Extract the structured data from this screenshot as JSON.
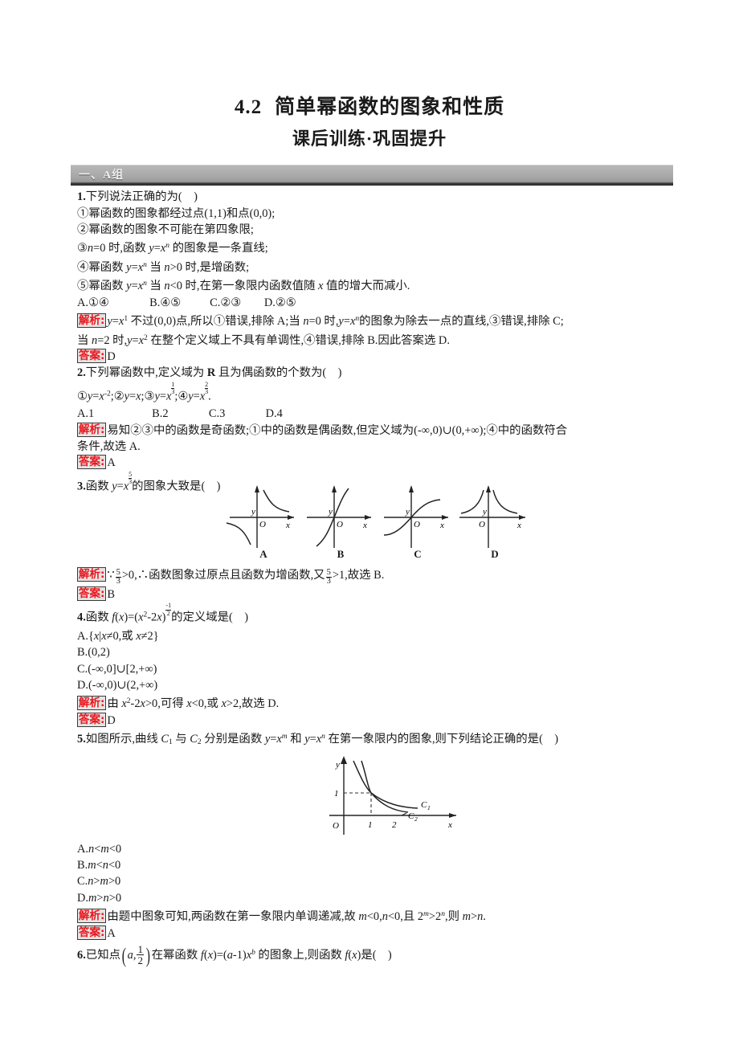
{
  "header": {
    "section_number": "4.2",
    "title": "简单幂函数的图象和性质",
    "subtitle": "课后训练·巩固提升",
    "group_bar_label": "一、A组",
    "bar_color": "#a8a8a8",
    "tag_color": "#e8161c"
  },
  "labels": {
    "analysis": "解析:",
    "answer": "答案:"
  },
  "questions": [
    {
      "number": "1.",
      "stem": "下列说法正确的为(　　)",
      "items": [
        "①幂函数的图象都经过点(1,1)和点(0,0);",
        "②幂函数的图象不可能在第四象限;",
        "③n=0 时,函数 y=xⁿ 的图象是一条直线;",
        "④幂函数 y=xⁿ 当 n>0 时,是增函数;",
        "⑤幂函数 y=xⁿ 当 n<0 时,在第一象限内函数值随 x 值的增大而减小."
      ],
      "options": [
        "A.①④",
        "B.④⑤",
        "C.②③",
        "D.②⑤"
      ],
      "analysis": "y=x¹ 不过(0,0)点,所以①错误,排除 A;当 n=0 时,y=xⁿ的图象为除去一点的直线,③错误,排除 C;当 n=2 时,y=x² 在整个定义域上不具有单调性,④错误,排除 B.因此答案选 D.",
      "answer": "D"
    },
    {
      "number": "2.",
      "stem": "下列幂函数中,定义域为 R 且为偶函数的个数为(　　)",
      "items": [
        "①y=x⁻²;②y=x;③y=x^(1/3);④y=x^(2/3)."
      ],
      "options": [
        "A.1",
        "B.2",
        "C.3",
        "D.4"
      ],
      "analysis": "易知②③中的函数是奇函数;①中的函数是偶函数,但定义域为(-∞,0)∪(0,+∞);④中的函数符合条件,故选 A.",
      "answer": "A"
    },
    {
      "number": "3.",
      "stem": "函数 y=x^(5/3)的图象大致是(　　)",
      "figure_labels": [
        "A",
        "B",
        "C",
        "D"
      ],
      "figure_axis_labels": {
        "y": "y",
        "x": "x",
        "origin": "O"
      },
      "analysis": "∵5/3>0,∴函数图象过原点且函数为增函数,又5/3>1,故选 B.",
      "answer": "B"
    },
    {
      "number": "4.",
      "stem": "函数 f(x)=(x²-2x)^(-1/2)的定义域是(　　)",
      "options": [
        "A.{x|x≠0,或 x≠2}",
        "B.(0,2)",
        "C.(-∞,0]∪[2,+∞)",
        "D.(-∞,0)∪(2,+∞)"
      ],
      "analysis": "由 x²-2x>0,可得 x<0,或 x>2,故选 D.",
      "answer": "D"
    },
    {
      "number": "5.",
      "stem": "如图所示,曲线 C₁ 与 C₂ 分别是函数 y=xᵐ 和 y=xⁿ 在第一象限内的图象,则下列结论正确的是(　　)",
      "figure": {
        "curve_labels": [
          "C₁",
          "C₂"
        ],
        "axis_labels": {
          "y": "y",
          "x": "x",
          "origin": "O"
        },
        "x_ticks": [
          "1",
          "2"
        ],
        "y_ticks": [
          "1"
        ],
        "intersection": "(1,1)"
      },
      "options": [
        "A.n<m<0",
        "B.m<n<0",
        "C.n>m>0",
        "D.m>n>0"
      ],
      "analysis": "由题中图象可知,两函数在第一象限内单调递减,故 m<0,n<0,且 2ᵐ>2ⁿ,则 m>n.",
      "answer": "A"
    },
    {
      "number": "6.",
      "stem": "已知点(a,1/2)在幂函数 f(x)=(a-1)xᵇ 的图象上,则函数 f(x)是(　　)"
    }
  ],
  "chart_data": [
    {
      "type": "line",
      "title": "Option A",
      "description": "decreasing odd power function, branches in quadrants I and III",
      "xlabel": "x",
      "ylabel": "y"
    },
    {
      "type": "line",
      "title": "Option B",
      "description": "increasing odd power function through origin, exponent greater than 1",
      "xlabel": "x",
      "ylabel": "y"
    },
    {
      "type": "line",
      "title": "Option C",
      "description": "increasing odd power function through origin, exponent between 0 and 1",
      "xlabel": "x",
      "ylabel": "y"
    },
    {
      "type": "line",
      "title": "Option D",
      "description": "even negative power function, branches in quadrants I and II",
      "xlabel": "x",
      "ylabel": "y"
    },
    {
      "type": "line",
      "title": "Q5 figure",
      "description": "two decreasing curves C1 and C2 in the first quadrant intersecting at (1,1)",
      "series": [
        {
          "name": "C₁",
          "points": [
            [
              0.45,
              3.2
            ],
            [
              1,
              1
            ],
            [
              2,
              0.55
            ],
            [
              2.8,
              0.42
            ]
          ]
        },
        {
          "name": "C₂",
          "points": [
            [
              0.6,
              3.2
            ],
            [
              1,
              1
            ],
            [
              2,
              0.38
            ],
            [
              2.6,
              0.25
            ]
          ]
        }
      ],
      "xlabel": "x",
      "ylabel": "y",
      "xticks": [
        1,
        2
      ],
      "yticks": [
        1
      ]
    }
  ]
}
